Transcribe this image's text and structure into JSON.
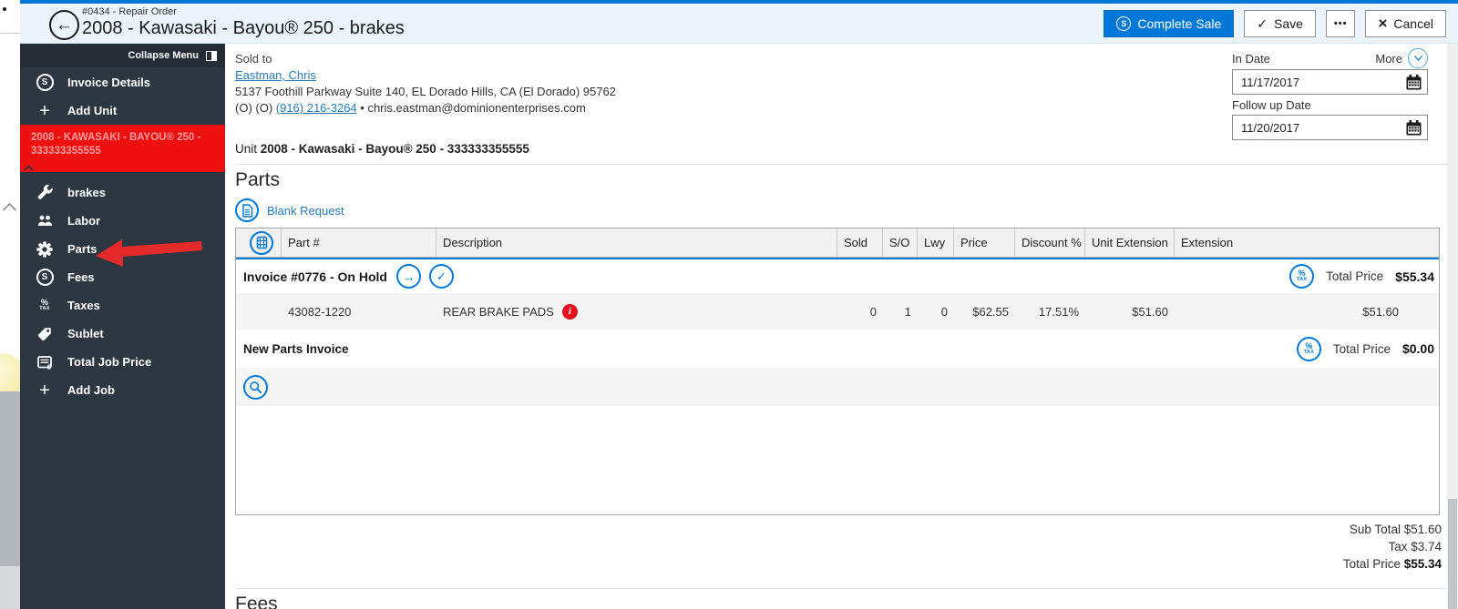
{
  "glyphs": {
    "back": "←",
    "forward": "→",
    "check": "✓",
    "close": "×",
    "ellipsis": "•••",
    "s": "S",
    "percent": "%",
    "tax": "TAX",
    "plus": "+",
    "bullet": "•"
  },
  "header": {
    "order_label": "#0434 - Repair Order",
    "title": "2008 - Kawasaki - Bayou® 250 - brakes",
    "buttons": {
      "complete_sale": "Complete Sale",
      "save": "Save",
      "cancel": "Cancel"
    }
  },
  "sidebar": {
    "collapse_label": "Collapse Menu",
    "top_items": [
      {
        "label": "Invoice Details"
      },
      {
        "label": "Add Unit"
      }
    ],
    "unit_item": "2008 - KAWASAKI - BAYOU® 250 - 333333355555",
    "job_items": [
      {
        "label": "brakes"
      },
      {
        "label": "Labor"
      },
      {
        "label": "Parts"
      },
      {
        "label": "Fees"
      },
      {
        "label": "Taxes"
      },
      {
        "label": "Sublet"
      },
      {
        "label": "Total Job Price"
      },
      {
        "label": "Add Job"
      }
    ]
  },
  "customer": {
    "sold_to_label": "Sold to",
    "name": "Eastman, Chris",
    "address": "5137 Foothill Parkway Suite 140, EL Dorado Hills, CA (El Dorado) 95762",
    "phone_prefix": "(O) (O) ",
    "phone": "(916) 216-3264",
    "separator": " • ",
    "email": "chris.eastman@dominionenterprises.com"
  },
  "dates": {
    "in_date_label": "In Date",
    "more_label": "More",
    "in_date": "11/17/2017",
    "follow_up_label": "Follow up Date",
    "follow_up_date": "11/20/2017"
  },
  "unit_line": {
    "label": "Unit ",
    "value": "2008 - Kawasaki - Bayou® 250 - 333333355555"
  },
  "parts": {
    "section_title": "Parts",
    "blank_request_label": "Blank Request",
    "columns": [
      "Part #",
      "Description",
      "Sold",
      "S/O",
      "Lwy",
      "Price",
      "Discount %",
      "Unit Extension",
      "Extension"
    ],
    "invoice_group": {
      "title": "Invoice #0776 - On Hold",
      "total_label": "Total Price",
      "total": "$55.34"
    },
    "rows": [
      {
        "part_number": "43082-1220",
        "description": "REAR BRAKE PADS",
        "sold": "0",
        "so": "1",
        "lwy": "0",
        "price": "$62.55",
        "discount": "17.51%",
        "unit_extension": "$51.60",
        "extension": "$51.60"
      }
    ],
    "new_invoice_group": {
      "title": "New Parts Invoice",
      "total_label": "Total Price",
      "total": "$0.00"
    },
    "totals": {
      "sub_total_label": "Sub Total ",
      "sub_total": "$51.60",
      "tax_label": "Tax ",
      "tax": "$3.74",
      "total_label": "Total Price ",
      "total": "$55.34"
    }
  },
  "fees": {
    "section_title": "Fees"
  }
}
